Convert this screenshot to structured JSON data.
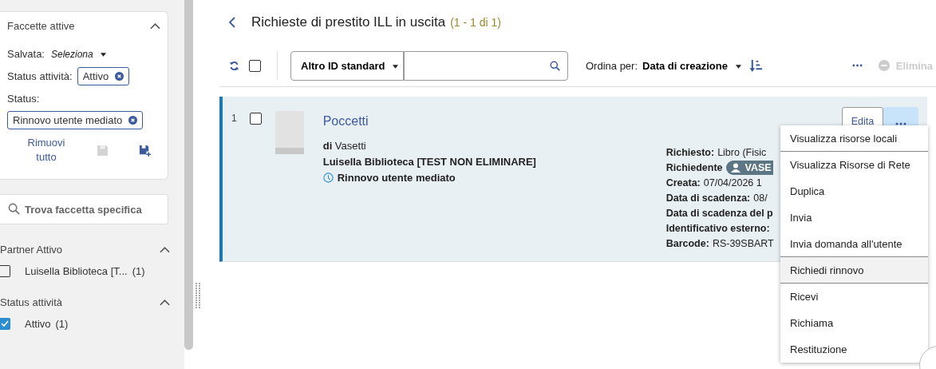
{
  "sidebar": {
    "active_facets": {
      "title": "Faccette attive",
      "expanded": true,
      "saved_label": "Salvata:",
      "saved_value": "Seleziona",
      "chips": [
        {
          "label": "Status attività:",
          "value": "Attivo",
          "inline": true
        },
        {
          "label": "Status:",
          "value": "Rinnovo utente mediato",
          "inline": false
        }
      ],
      "remove_all": "Rimuovi tutto"
    },
    "facet_search": {
      "placeholder": "Trova faccetta specifica"
    },
    "groups": [
      {
        "title": "Partner Attivo",
        "expanded": true,
        "items": [
          {
            "label": "Luisella Biblioteca [T...",
            "count": "(1)",
            "checked": false
          }
        ]
      },
      {
        "title": "Status attività",
        "expanded": true,
        "items": [
          {
            "label": "Attivo",
            "count": "(1)",
            "checked": true
          }
        ]
      }
    ]
  },
  "header": {
    "title": "Richieste di prestito ILL in uscita",
    "count": "(1 - 1 di 1)"
  },
  "toolbar": {
    "select_all": false,
    "search_scope": "Altro ID standard",
    "sort_label": "Ordina per:",
    "sort_value": "Data di creazione",
    "delete": "Elimina",
    "delete_disabled": true
  },
  "rows": [
    {
      "index": "1",
      "checked": false,
      "selected": true,
      "title": "Poccetti",
      "author_prefix": "di",
      "author": "Vasetti",
      "partner": "Luisella Biblioteca [TEST NON ELIMINARE]",
      "status": "Rinnovo utente mediato",
      "details": [
        {
          "label": "Richiesto:",
          "value": "Libro (Fisic"
        },
        {
          "label": "Richiedente",
          "value": "VASE",
          "kind": "user"
        },
        {
          "label": "Creata:",
          "value": "07/04/2026 1"
        },
        {
          "label": "Data di scadenza:",
          "value": "08/"
        },
        {
          "label": "Data di scadenza del p"
        },
        {
          "label": "Identificativo esterno:"
        },
        {
          "label": "Barcode:",
          "value": "RS-39SBART"
        }
      ],
      "edit": "Edita"
    }
  ],
  "menu": {
    "items": [
      {
        "label": "Visualizza risorse locali",
        "selected": false,
        "separator": true
      },
      {
        "label": "Visualizza Risorse di Rete",
        "selected": false,
        "separator": false
      },
      {
        "label": "Duplica",
        "selected": false,
        "separator": false
      },
      {
        "label": "Invia",
        "selected": false,
        "separator": false
      },
      {
        "label": "Invia domanda all'utente",
        "selected": false,
        "separator": true
      },
      {
        "label": "Richiedi rinnovo",
        "selected": true,
        "separator": true
      },
      {
        "label": "Ricevi",
        "selected": false,
        "separator": false
      },
      {
        "label": "Richiama",
        "selected": false,
        "separator": false
      },
      {
        "label": "Restituzione",
        "selected": false,
        "separator": false
      }
    ]
  }
}
